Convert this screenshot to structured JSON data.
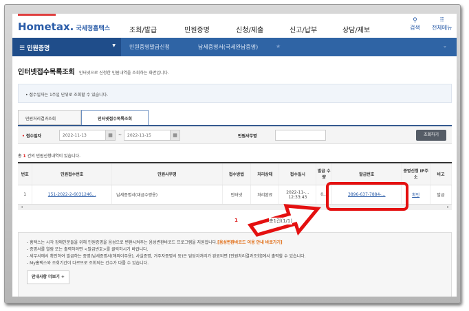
{
  "header": {
    "logo": "Hometax.",
    "logo_sub": "국세청홈택스",
    "nav": [
      "조회/발급",
      "민원증명",
      "신청/제출",
      "신고/납부",
      "상담/제보"
    ],
    "search": "검색",
    "all_menu": "전체메뉴"
  },
  "breadcrumb": {
    "menu": "민원증명",
    "items": [
      "민원증명발급신청",
      "납세증명서(국세완납증명)"
    ]
  },
  "page": {
    "title": "인터넷접수목록조회",
    "desc": "인터넷으로 신청한 민원내역을 조회하는 화면입니다."
  },
  "notice": "• 접수일자는 1주일 단위로 조회할 수 있습니다.",
  "tabs": [
    "민원처리결과조회",
    "인터넷접수목록조회"
  ],
  "search": {
    "date_label": "접수일자",
    "from": "2022-11-13",
    "tilde": "~",
    "to": "2022-11-15",
    "type_label": "민원사무명",
    "type_value": "",
    "submit": "조회하기"
  },
  "count": {
    "prefix": "총",
    "n": "1",
    "suffix": "건의 민원신청내역이 있습니다."
  },
  "table": {
    "headers": [
      "번호",
      "민원접수번호",
      "민원사무명",
      "접수방법",
      "처리상태",
      "접수일시",
      "발급 수량",
      "발급번호",
      "증명신청 IP주소",
      "비고"
    ],
    "rows": [
      [
        "1",
        "151-2022-2-6031246…",
        "납세증명서(대금수령용)",
        "인터넷",
        "처리완료",
        "2022-11-… 12:33:43",
        "0…",
        "3896-637-7884-…",
        "확인",
        "발급"
      ]
    ]
  },
  "pager": {
    "annotation": "1",
    "text": "총1건(1/1)"
  },
  "notes": {
    "lines": [
      "- 홈택스는 시각 장애인분들을 위해 민원증명을 음성으로 변환시켜주는 음성변환바코드 프로그램을 지원합니다.",
      "- 증명서를 열람 또는 출력하려면 <발급번호>를 클릭하시기 바랍니다.",
      "- 세무서에서 확인하여 발급하는 증명(납세증명서(해외이주용), 사실증명, 거주자증명서 등)은 담당자처리가 완료되면 [민원처리결과조회]에서 출력할 수 있습니다.",
      "- My홈택스와 조회기간이 다르므로 조회되는 건수가 다를 수 있습니다."
    ],
    "link": "[음성변환바코드 이용 안내 바로가기]",
    "more": "안내사항 더보기 +"
  }
}
